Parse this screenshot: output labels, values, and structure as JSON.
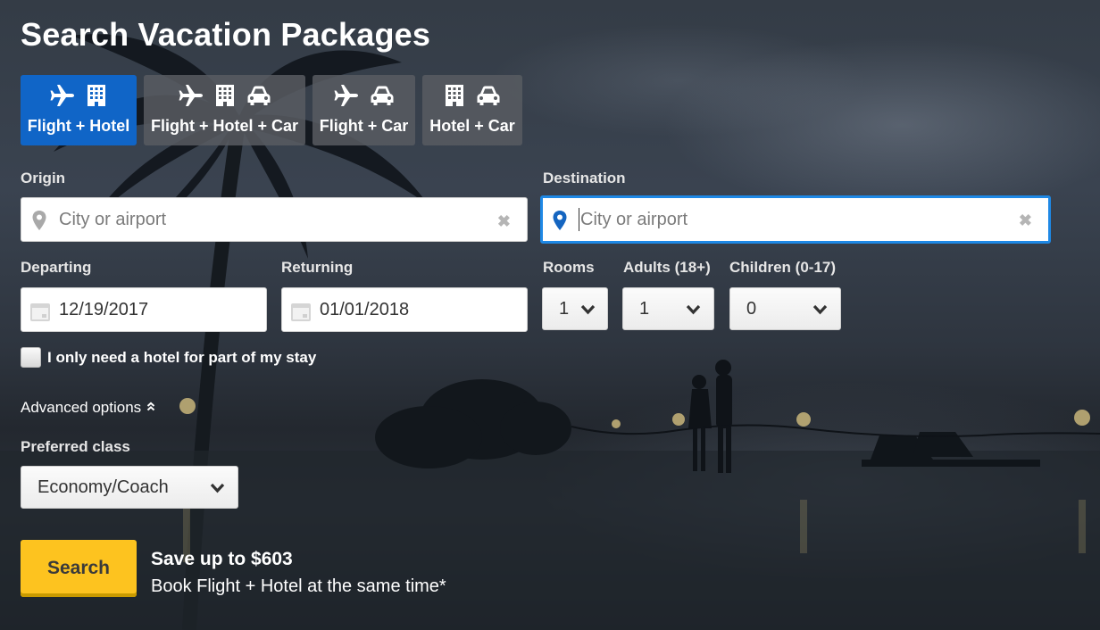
{
  "page": {
    "title": "Search Vacation Packages"
  },
  "tabs": [
    {
      "label": "Flight + Hotel",
      "icons": [
        "airplane-icon",
        "building-icon"
      ],
      "active": true
    },
    {
      "label": "Flight + Hotel + Car",
      "icons": [
        "airplane-icon",
        "building-icon",
        "car-icon"
      ],
      "active": false
    },
    {
      "label": "Flight + Car",
      "icons": [
        "airplane-icon",
        "car-icon"
      ],
      "active": false
    },
    {
      "label": "Hotel + Car",
      "icons": [
        "building-icon",
        "car-icon"
      ],
      "active": false
    }
  ],
  "origin": {
    "label": "Origin",
    "placeholder": "City or airport",
    "value": ""
  },
  "destination": {
    "label": "Destination",
    "placeholder": "City or airport",
    "value": ""
  },
  "departing": {
    "label": "Departing",
    "value": "12/19/2017"
  },
  "returning": {
    "label": "Returning",
    "value": "01/01/2018"
  },
  "rooms": {
    "label": "Rooms",
    "value": "1"
  },
  "adults": {
    "label": "Adults (18+)",
    "value": "1"
  },
  "children": {
    "label": "Children (0-17)",
    "value": "0"
  },
  "partial_stay": {
    "label": "I only need a hotel for part of my stay",
    "checked": false
  },
  "advanced": {
    "label": "Advanced options",
    "expanded": true
  },
  "preferred_class": {
    "label": "Preferred class",
    "value": "Economy/Coach"
  },
  "search_button": {
    "label": "Search"
  },
  "promo": {
    "title": "Save up to $603",
    "subtitle": "Book Flight + Hotel at the same time*"
  },
  "colors": {
    "active_tab": "#1065c7",
    "search_button": "#fdc31f",
    "focus_ring": "#1e88e5"
  }
}
